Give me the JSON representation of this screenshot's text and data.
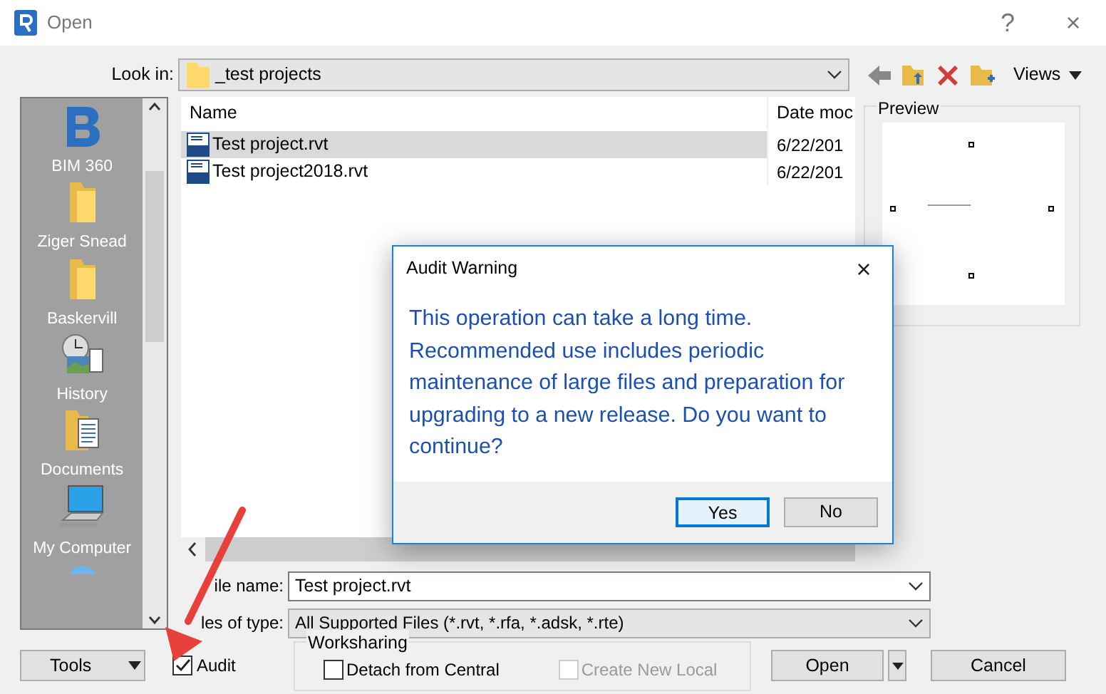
{
  "window": {
    "title": "Open",
    "help": "?",
    "close": "×"
  },
  "look_in": {
    "label": "Look in:",
    "value": "_test projects"
  },
  "toolbar": {
    "views": "Views"
  },
  "places": [
    {
      "kind": "logo",
      "label": "BIM 360"
    },
    {
      "kind": "folder",
      "label": "Ziger Snead"
    },
    {
      "kind": "folder",
      "label": "Baskervill"
    },
    {
      "kind": "history",
      "label": "History"
    },
    {
      "kind": "documents",
      "label": "Documents"
    },
    {
      "kind": "computer",
      "label": "My Computer"
    },
    {
      "kind": "network"
    }
  ],
  "file_list": {
    "columns": [
      "Name",
      "Date moc"
    ],
    "rows": [
      {
        "name": "Test project.rvt",
        "date": "6/22/201",
        "selected": true
      },
      {
        "name": "Test project2018.rvt",
        "date": "6/22/201",
        "selected": false
      }
    ]
  },
  "preview": {
    "title": "Preview"
  },
  "file_name": {
    "label": "ile name:",
    "value": "Test project.rvt"
  },
  "file_type": {
    "label": "les of type:",
    "value": "All Supported Files  (*.rvt, *.rfa, *.adsk, *.rte)"
  },
  "tools": {
    "label": "Tools"
  },
  "audit": {
    "label": "Audit",
    "checked": true
  },
  "worksharing": {
    "title": "Worksharing",
    "options": [
      {
        "label": "Detach from Central",
        "checked": false,
        "disabled": false
      },
      {
        "label": "Create New Local",
        "checked": false,
        "disabled": true
      }
    ]
  },
  "actions": [
    {
      "label": "Open",
      "kind": "split"
    },
    {
      "label": "Cancel",
      "kind": "plain"
    }
  ],
  "alert": {
    "title": "Audit Warning",
    "close": "×",
    "message": "This operation can take a long time. Recommended use includes periodic maintenance of large files and preparation for upgrading to a new release. Do you want to continue?",
    "buttons": [
      {
        "label": "Yes",
        "default": true
      },
      {
        "label": "No",
        "default": false
      }
    ]
  }
}
